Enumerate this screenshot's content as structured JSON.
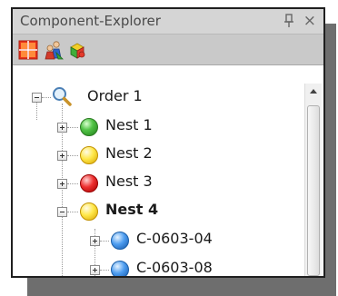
{
  "panel": {
    "title": "Component-Explorer",
    "pin_icon": "pin-icon",
    "close_label": "×"
  },
  "toolbar": {
    "buttons": [
      {
        "icon": "grid-view-icon"
      },
      {
        "icon": "users-icon"
      },
      {
        "icon": "components-icon"
      }
    ]
  },
  "tree": {
    "order": {
      "label": "Order 1",
      "icon": "search-icon",
      "expanded": true
    },
    "items": [
      {
        "label": "Nest 1",
        "status_color": "green",
        "expanded": false
      },
      {
        "label": "Nest 2",
        "status_color": "yellow",
        "expanded": false
      },
      {
        "label": "Nest 3",
        "status_color": "red",
        "expanded": false
      },
      {
        "label": "Nest 4",
        "status_color": "yellow",
        "expanded": true,
        "bold": true
      },
      {
        "label": "C-0603-04",
        "status_color": "blue",
        "expanded": false
      },
      {
        "label": "C-0603-08",
        "status_color": "blue",
        "expanded": false
      }
    ]
  },
  "colors": {
    "green": "#3ab02f",
    "yellow": "#ffe84a",
    "red": "#ee3030",
    "blue": "#4d9df0"
  }
}
